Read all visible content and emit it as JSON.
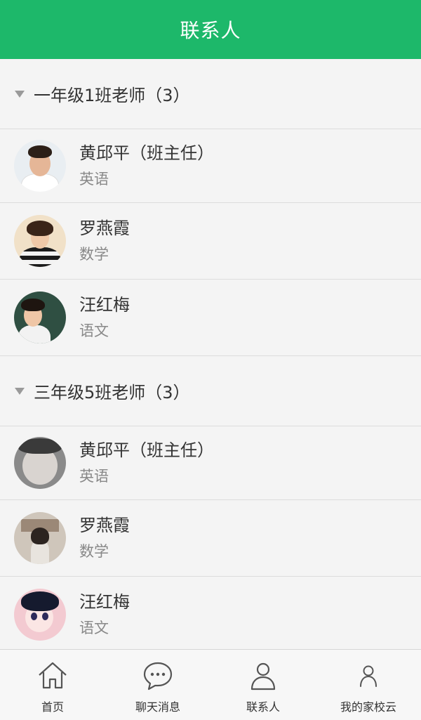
{
  "header": {
    "title": "联系人"
  },
  "groups": [
    {
      "title": "一年级1班老师（3）",
      "contacts": [
        {
          "name": "黄邱平（班主任）",
          "subject": "英语"
        },
        {
          "name": "罗燕霞",
          "subject": "数学"
        },
        {
          "name": "汪红梅",
          "subject": "语文"
        }
      ]
    },
    {
      "title": "三年级5班老师（3）",
      "contacts": [
        {
          "name": "黄邱平（班主任）",
          "subject": "英语"
        },
        {
          "name": "罗燕霞",
          "subject": "数学"
        },
        {
          "name": "汪红梅",
          "subject": "语文"
        }
      ]
    }
  ],
  "tabbar": {
    "items": [
      {
        "label": "首页",
        "icon": "home-icon"
      },
      {
        "label": "聊天消息",
        "icon": "chat-bubble-icon"
      },
      {
        "label": "联系人",
        "icon": "person-icon"
      },
      {
        "label": "我的家校云",
        "icon": "user-profile-icon"
      }
    ]
  },
  "colors": {
    "accent": "#1db86a",
    "background": "#f4f4f4",
    "divider": "#dcdcdc"
  }
}
